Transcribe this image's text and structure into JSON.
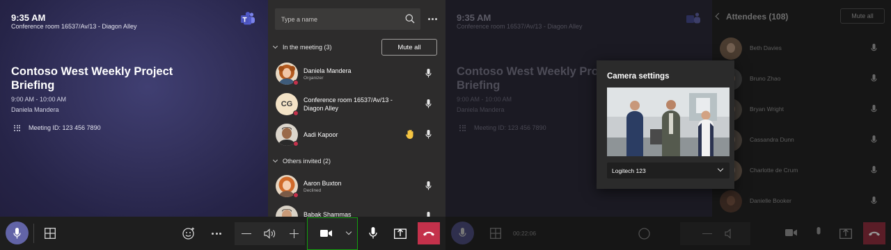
{
  "colors": {
    "accent": "#6264a7",
    "danger": "#c4314b",
    "focus": "#13a10e",
    "panel": "#2d2c2c",
    "toolbar": "#1e1e1e"
  },
  "meeting": {
    "time": "9:35 AM",
    "room": "Conference room 16537/Av/13 - Diagon Alley",
    "title": "Contoso West Weekly Project Briefing",
    "time_range": "9:00 AM - 10:00 AM",
    "organizer": "Daniela Mandera",
    "meeting_id": "Meeting ID: 123 456 7890"
  },
  "people_panel": {
    "search_placeholder": "Type a name",
    "in_meeting_label": "In the meeting (3)",
    "mute_all": "Mute all",
    "in_meeting": [
      {
        "name": "Daniela Mandera",
        "sub": "Organizer",
        "avatar": "photo-woman-curly-hair"
      },
      {
        "name": "Conference room 16537/Av/13 - Diagon Alley",
        "sub": "",
        "initials": "CG"
      },
      {
        "name": "Aadi Kapoor",
        "sub": "",
        "avatar": "photo-man",
        "hand_raised": true
      }
    ],
    "others_label": "Others invited (2)",
    "others": [
      {
        "name": "Aaron Buxton",
        "sub": "Declined",
        "avatar": "photo-woman-red-hair"
      },
      {
        "name": "Babak Shammas",
        "sub": "",
        "avatar": "photo-man-2"
      }
    ]
  },
  "toolbar": {
    "icons": [
      "mic-icon",
      "grid-view-icon",
      "reactions-icon",
      "more-icon",
      "volume-down-icon",
      "speaker-icon",
      "volume-up-icon",
      "camera-icon",
      "camera-options-chevron-icon",
      "mic-icon",
      "share-tray-icon",
      "hang-up-icon"
    ],
    "call_duration": "00:22:06"
  },
  "attendees_panel": {
    "title": "Attendees (108)",
    "mute_all": "Mute all",
    "people": [
      "Beth Davies",
      "Bruno Zhao",
      "Bryan Wright",
      "Cassandra Dunn",
      "Charlotte de Crum",
      "Danielle Booker"
    ]
  },
  "camera_settings": {
    "title": "Camera settings",
    "selected_camera": "Logitech 123"
  }
}
